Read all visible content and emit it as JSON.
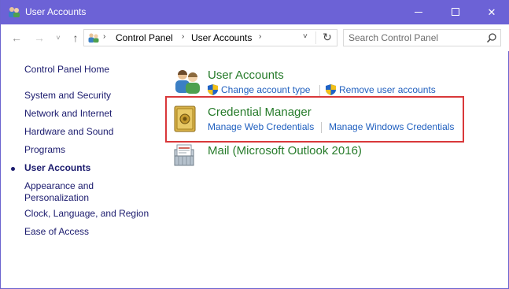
{
  "window": {
    "title": "User Accounts",
    "controls": {
      "minimize": "minimize-icon",
      "maximize": "maximize-icon",
      "close": "✕"
    }
  },
  "nav": {
    "back": "←",
    "forward": "→",
    "recent": "˅",
    "up": "↑"
  },
  "address": {
    "breadcrumbs": [
      "Control Panel",
      "User Accounts"
    ],
    "separator": "›",
    "dropdown": "˅",
    "refresh": "↻"
  },
  "search": {
    "placeholder": "Search Control Panel"
  },
  "sidebar": {
    "home": "Control Panel Home",
    "items": [
      "System and Security",
      "Network and Internet",
      "Hardware and Sound",
      "Programs",
      "User Accounts",
      "Appearance and\nPersonalization",
      "Clock, Language, and Region",
      "Ease of Access"
    ],
    "current_index": 4
  },
  "main": {
    "categories": [
      {
        "title": "User Accounts",
        "icon": "users-icon",
        "links": [
          "Change account type",
          "Remove user accounts"
        ],
        "link_icons": [
          "shield-icon",
          "shield-icon"
        ]
      },
      {
        "title": "Credential Manager",
        "icon": "safe-icon",
        "links": [
          "Manage Web Credentials",
          "Manage Windows Credentials"
        ]
      },
      {
        "title": "Mail (Microsoft Outlook 2016)",
        "icon": "mail-icon",
        "links": []
      }
    ]
  },
  "colors": {
    "titlebar": "#6c62d6",
    "category_title": "#267b2a",
    "link": "#1f5fbf",
    "highlight": "#d9383a"
  }
}
